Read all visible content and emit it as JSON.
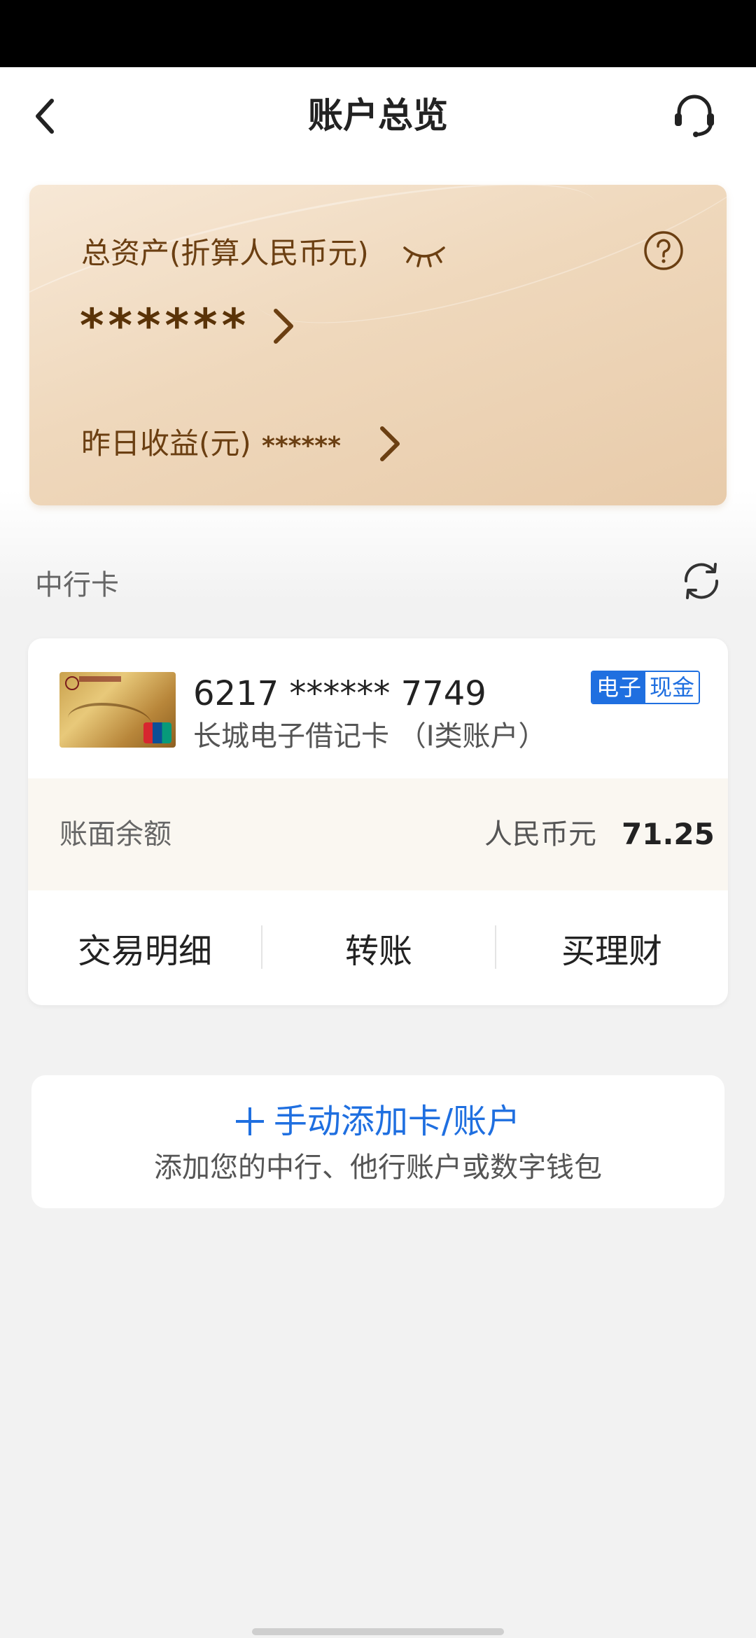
{
  "header": {
    "title": "账户总览"
  },
  "asset_card": {
    "label": "总资产(折算人民币元)",
    "value": "******",
    "yield_label": "昨日收益(元)",
    "yield_value": "******"
  },
  "section": {
    "title": "中行卡"
  },
  "bank_card": {
    "number": "6217 ****** 7749",
    "name": "长城电子借记卡 （I类账户）",
    "tag_left": "电子",
    "tag_right": "现金",
    "balance_label": "账面余额",
    "currency": "人民币元",
    "amount": "71.25",
    "actions": [
      "交易明细",
      "转账",
      "买理财"
    ]
  },
  "add_account": {
    "title": "手动添加卡/账户",
    "subtitle": "添加您的中行、他行账户或数字钱包"
  },
  "colors": {
    "accent_blue": "#1f6fe0",
    "card_gold_text": "#6b3f12"
  }
}
